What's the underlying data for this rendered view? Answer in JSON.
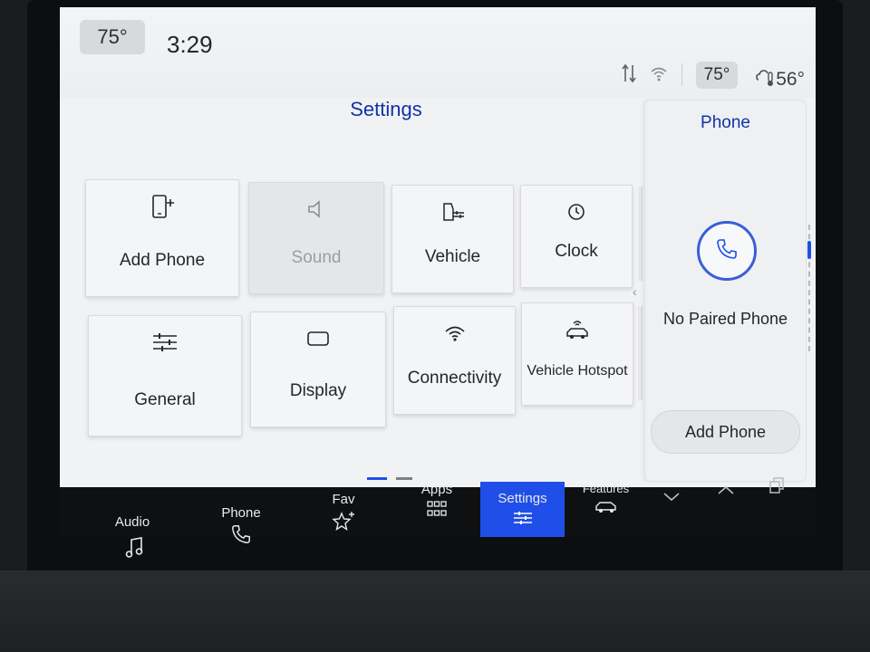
{
  "status_bar": {
    "interior_temp": "75°",
    "time": "3:29",
    "passenger_temp": "75°",
    "outside_temp": "56°",
    "icons": [
      "sort-arrows-icon",
      "wifi-icon",
      "cloud-thermometer-icon"
    ]
  },
  "settings": {
    "title": "Settings",
    "tiles": [
      {
        "label": "Add Phone",
        "icon": "add-phone-icon",
        "enabled": true
      },
      {
        "label": "Sound",
        "icon": "speaker-icon",
        "enabled": false
      },
      {
        "label": "Vehicle",
        "icon": "vehicle-settings-icon",
        "enabled": true
      },
      {
        "label": "Clock",
        "icon": "clock-icon",
        "enabled": true
      },
      {
        "label": "General",
        "icon": "sliders-icon",
        "enabled": true
      },
      {
        "label": "Display",
        "icon": "display-icon",
        "enabled": true
      },
      {
        "label": "Connectivity",
        "icon": "wifi-icon",
        "enabled": true
      },
      {
        "label": "Vehicle Hotspot",
        "icon": "car-wifi-icon",
        "enabled": true
      }
    ],
    "page_indicator": {
      "current": 1,
      "total": 2
    }
  },
  "phone_panel": {
    "title": "Phone",
    "status": "No Paired Phone",
    "button_label": "Add Phone"
  },
  "bottom_nav": {
    "items": [
      {
        "label": "Audio",
        "icon": "music-note-icon"
      },
      {
        "label": "Phone",
        "icon": "phone-icon"
      },
      {
        "label": "Fav",
        "icon": "star-plus-icon"
      },
      {
        "label": "Apps",
        "icon": "grid-icon"
      },
      {
        "label": "Settings",
        "icon": "sliders-icon",
        "active": true
      },
      {
        "label": "Features",
        "icon": "car-icon"
      }
    ],
    "controls": [
      "chevron-down-icon",
      "chevron-up-icon",
      "copy-icon"
    ]
  },
  "colors": {
    "accent": "#1f4fe8",
    "title_blue": "#1232a8",
    "screen_bg": "#f1f2f4",
    "nav_bg": "#0f1012"
  }
}
